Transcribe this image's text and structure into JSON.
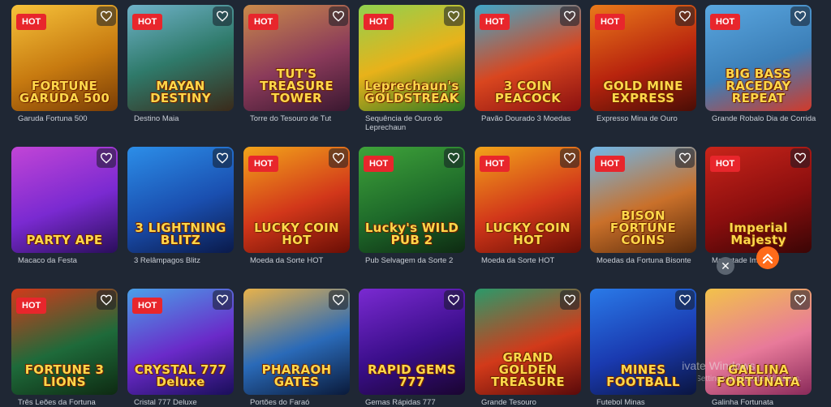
{
  "badge_label": "HOT",
  "games": [
    {
      "title": "Garuda Fortuna 500",
      "logo": "FORTUNE GARUDA 500",
      "hot": true,
      "bg": "linear-gradient(160deg,#f6c23a,#c77a10 55%,#7a3d05)"
    },
    {
      "title": "Destino Maia",
      "logo": "MAYAN DESTINY",
      "hot": true,
      "bg": "linear-gradient(160deg,#6fb2c9,#2f7a6a 50%,#3a2a1a)"
    },
    {
      "title": "Torre do Tesouro de Tut",
      "logo": "TUT'S TREASURE TOWER",
      "hot": true,
      "bg": "linear-gradient(160deg,#c98a4a,#8a3a5a 55%,#3a1830)"
    },
    {
      "title": "Sequência de Ouro do Leprechaun",
      "logo": "Leprechaun's GOLDSTREAK",
      "hot": true,
      "bg": "linear-gradient(160deg,#8fd14f,#e8b21a 50%,#2f7a22)"
    },
    {
      "title": "Pavão Dourado 3 Moedas",
      "logo": "3 COIN PEACOCK",
      "hot": true,
      "bg": "linear-gradient(160deg,#3fa8c9,#d9461f 55%,#8a1010)"
    },
    {
      "title": "Expresso Mina de Ouro",
      "logo": "GOLD MINE EXPRESS",
      "hot": true,
      "bg": "linear-gradient(160deg,#e97a1a,#b8240e 55%,#4a0d05)"
    },
    {
      "title": "Grande Robalo Dia de Corrida",
      "logo": "BIG BASS RACEDAY REPEAT",
      "hot": true,
      "bg": "linear-gradient(160deg,#5aa7e0,#3c7fb8 55%,#d23a2a)"
    },
    {
      "title": "Macaco da Festa",
      "logo": "PARTY APE",
      "hot": false,
      "bg": "linear-gradient(160deg,#c245d6,#7a2ad1 55%,#2a0e5a)"
    },
    {
      "title": "3 Relâmpagos Blitz",
      "logo": "3 LIGHTNING BLITZ",
      "hot": false,
      "bg": "linear-gradient(160deg,#2c8ee8,#1a4fb0 55%,#0a1a4a)"
    },
    {
      "title": "Moeda da Sorte HOT",
      "logo": "LUCKY COIN HOT",
      "hot": true,
      "bg": "linear-gradient(160deg,#f2a41a,#d2371a 55%,#6a0e05)"
    },
    {
      "title": "Pub Selvagem da Sorte 2",
      "logo": "Lucky's WILD PUB 2",
      "hot": true,
      "bg": "linear-gradient(160deg,#3fa33a,#1e6a2a 55%,#0e2a12)"
    },
    {
      "title": "Moeda da Sorte HOT",
      "logo": "LUCKY COIN HOT",
      "hot": true,
      "bg": "linear-gradient(160deg,#f2a41a,#d2371a 55%,#6a0e05)"
    },
    {
      "title": "Moedas da Fortuna Bisonte",
      "logo": "BISON FORTUNE COINS",
      "hot": true,
      "bg": "linear-gradient(160deg,#6fb6e8,#c9702a 55%,#5a2a0a)"
    },
    {
      "title": "Majestade Imperial",
      "title_visible": "Majestade Im",
      "logo": "Imperial Majesty",
      "hot": true,
      "bg": "linear-gradient(160deg,#c9251a,#8a0e0e 55%,#3a0505)"
    },
    {
      "title": "Três Leões da Fortuna",
      "title_visible": "Três Leões da Fortuna",
      "logo": "FORTUNE 3 LIONS",
      "hot": true,
      "bg": "linear-gradient(160deg,#d23a1a,#1e6a3a 55%,#0e2a12)"
    },
    {
      "title": "Cristal 777 Deluxe",
      "logo": "CRYSTAL 777 Deluxe",
      "hot": true,
      "bg": "linear-gradient(160deg,#4aa0e8,#6a2ac9 55%,#1a0e5a)"
    },
    {
      "title": "Portões do Faraó",
      "logo": "PHARAOH GATES",
      "hot": false,
      "bg": "linear-gradient(160deg,#e8b24a,#2a6ab8 55%,#0a1a3a)"
    },
    {
      "title": "Gemas Rápidas 777",
      "logo": "RAPID GEMS 777",
      "hot": false,
      "bg": "linear-gradient(160deg,#7a2ad1,#3a0e8a 55%,#1a0530)"
    },
    {
      "title": "Grande Tesouro",
      "logo": "GRAND GOLDEN TREASURE",
      "hot": false,
      "bg": "linear-gradient(160deg,#2a9a6a,#d23a1a 55%,#5a0a0a)"
    },
    {
      "title": "Futebol Minas",
      "logo": "MINES FOOTBALL",
      "hot": false,
      "bg": "linear-gradient(160deg,#2a7ae8,#1a3ab0 55%,#0a1540)"
    },
    {
      "title": "Galinha Fortunata",
      "logo": "GALLINA FORTUNATA",
      "hot": false,
      "bg": "linear-gradient(160deg,#f2c24a,#e87a9a 55%,#8a2a5a)"
    }
  ],
  "overlay": {
    "close_glyph": "✕",
    "watermark": "Activate Windows",
    "watermark_sub": "Go to Settings to activate Windows."
  },
  "colors": {
    "hot": "#e8262c",
    "scroll_top": "#ff6b1a",
    "background": "#1f2734"
  }
}
